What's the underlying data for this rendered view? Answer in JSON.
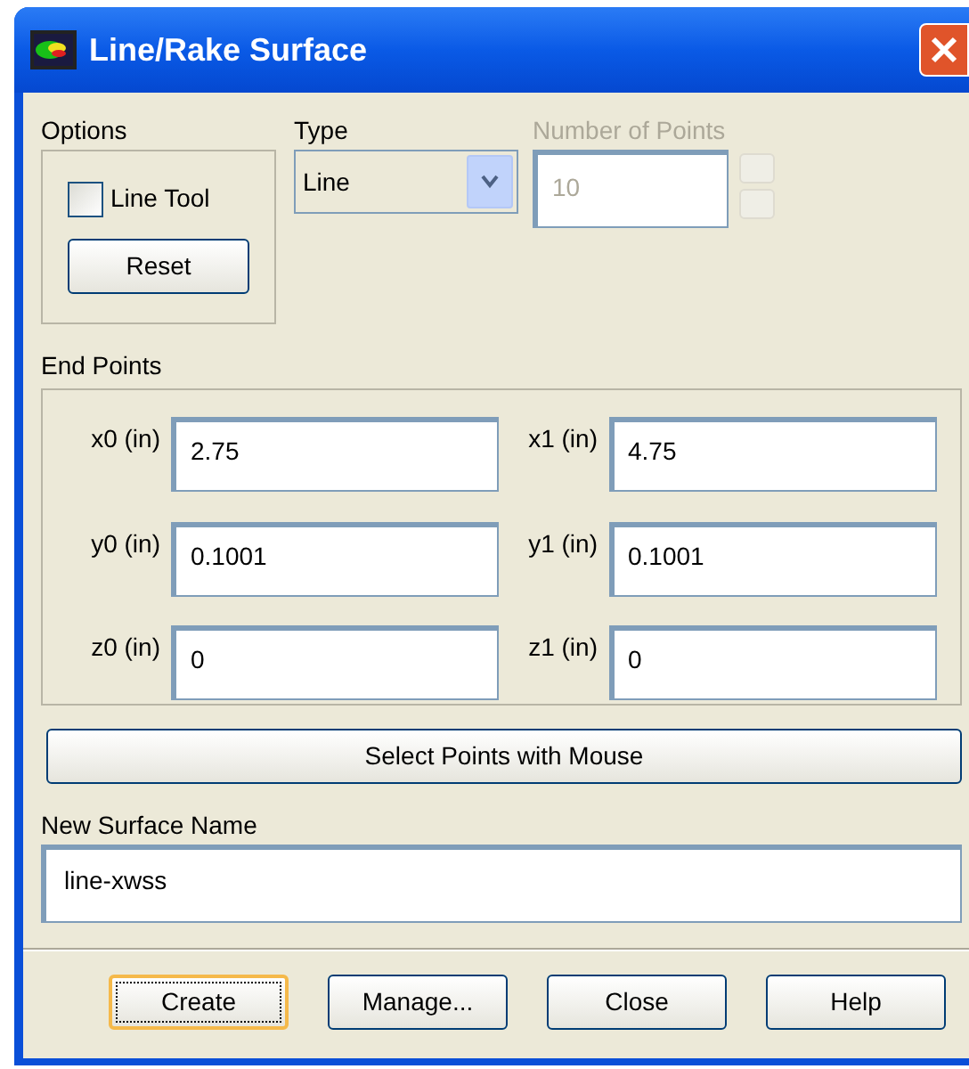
{
  "window": {
    "title": "Line/Rake Surface"
  },
  "options": {
    "label": "Options",
    "line_tool": {
      "label": "Line Tool",
      "checked": false
    },
    "reset_button": "Reset"
  },
  "type": {
    "label": "Type",
    "value": "Line"
  },
  "number_of_points": {
    "label": "Number of Points",
    "value": "10",
    "disabled": true
  },
  "end_points": {
    "label": "End Points",
    "fields": [
      {
        "label": "x0 (in)",
        "value": "2.75"
      },
      {
        "label": "x1 (in)",
        "value": "4.75"
      },
      {
        "label": "y0 (in)",
        "value": "0.1001"
      },
      {
        "label": "y1 (in)",
        "value": "0.1001"
      },
      {
        "label": "z0 (in)",
        "value": "0"
      },
      {
        "label": "z1 (in)",
        "value": "0"
      }
    ]
  },
  "select_button": "Select Points with Mouse",
  "new_surface_name": {
    "label": "New Surface Name",
    "value": "line-xwss"
  },
  "buttons": [
    {
      "label": "Create",
      "focused": true
    },
    {
      "label": "Manage...",
      "focused": false
    },
    {
      "label": "Close",
      "focused": false
    },
    {
      "label": "Help",
      "focused": false
    }
  ]
}
